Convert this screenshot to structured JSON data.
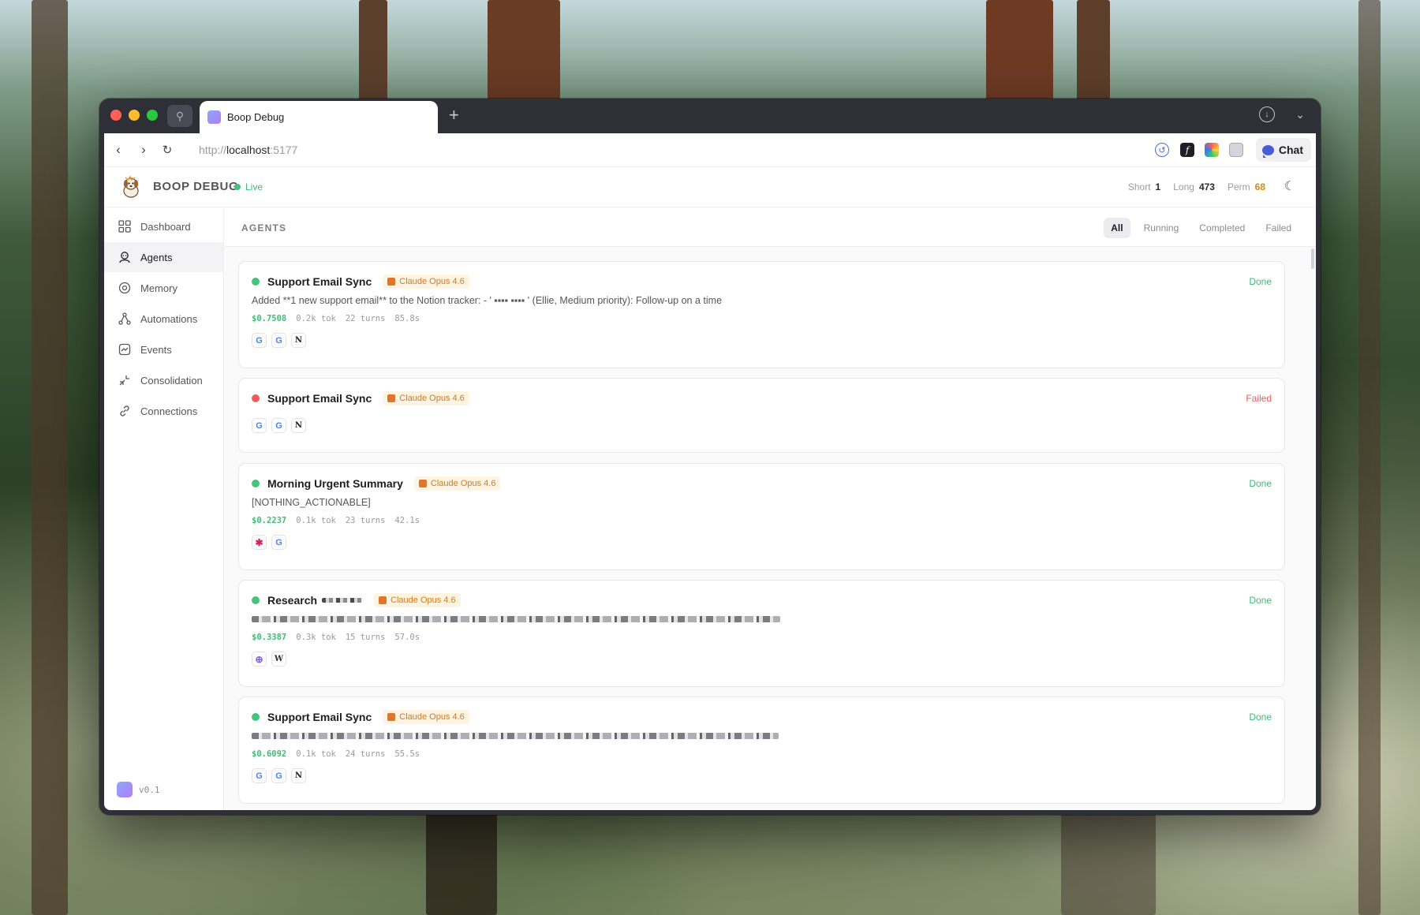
{
  "browser": {
    "tab_title": "Boop Debug",
    "new_tab": "+",
    "url_scheme": "http://",
    "url_host": "localhost",
    "url_port": ":5177",
    "chat_button": "Chat"
  },
  "app": {
    "title": "BOOP DEBUG",
    "live": "Live",
    "stats": [
      {
        "label": "Short",
        "value": "1"
      },
      {
        "label": "Long",
        "value": "473"
      },
      {
        "label": "Perm",
        "value": "68"
      }
    ],
    "version": "v0.1"
  },
  "sidebar": {
    "items": [
      {
        "label": "Dashboard",
        "icon": "grid-icon"
      },
      {
        "label": "Agents",
        "icon": "agent-icon"
      },
      {
        "label": "Memory",
        "icon": "memory-icon"
      },
      {
        "label": "Automations",
        "icon": "workflow-icon"
      },
      {
        "label": "Events",
        "icon": "events-icon"
      },
      {
        "label": "Consolidation",
        "icon": "consolidation-icon"
      },
      {
        "label": "Connections",
        "icon": "link-icon"
      }
    ],
    "active": "Agents"
  },
  "main": {
    "section_title": "AGENTS",
    "filters": [
      "All",
      "Running",
      "Completed",
      "Failed"
    ],
    "active_filter": "All",
    "cards": [
      {
        "title": "Support Email Sync",
        "model": "Claude Opus 4.6",
        "status": "Done",
        "description": "Added **1 new support email** to the Notion tracker: - ' ▪▪▪▪ ▪▪▪▪ ' (Ellie, Medium priority): Follow-up on a time",
        "cost": "$0.7508",
        "tokens": "0.2k tok",
        "turns": "22 turns",
        "duration": "85.8s",
        "tools": [
          "G",
          "G",
          "N"
        ]
      },
      {
        "title": "Support Email Sync",
        "model": "Claude Opus 4.6",
        "status": "Failed",
        "tools": [
          "G",
          "G",
          "N"
        ]
      },
      {
        "title": "Morning Urgent Summary",
        "model": "Claude Opus 4.6",
        "status": "Done",
        "description": "[NOTHING_ACTIONABLE]",
        "cost": "$0.2237",
        "tokens": "0.1k tok",
        "turns": "23 turns",
        "duration": "42.1s",
        "tools": [
          "✱",
          "G"
        ]
      },
      {
        "title": "Research",
        "model": "Claude Opus 4.6",
        "status": "Done",
        "cost": "$0.3387",
        "tokens": "0.3k tok",
        "turns": "15 turns",
        "duration": "57.0s",
        "tools": [
          "⊕",
          "W"
        ]
      },
      {
        "title": "Support Email Sync",
        "model": "Claude Opus 4.6",
        "status": "Done",
        "cost": "$0.6092",
        "tokens": "0.1k tok",
        "turns": "24 turns",
        "duration": "55.5s",
        "tools": [
          "G",
          "G",
          "N"
        ]
      }
    ]
  },
  "colors": {
    "done": "#43c47a",
    "failed": "#ee5b61",
    "badge": "#d27a1a",
    "perm": "#d5891a"
  }
}
